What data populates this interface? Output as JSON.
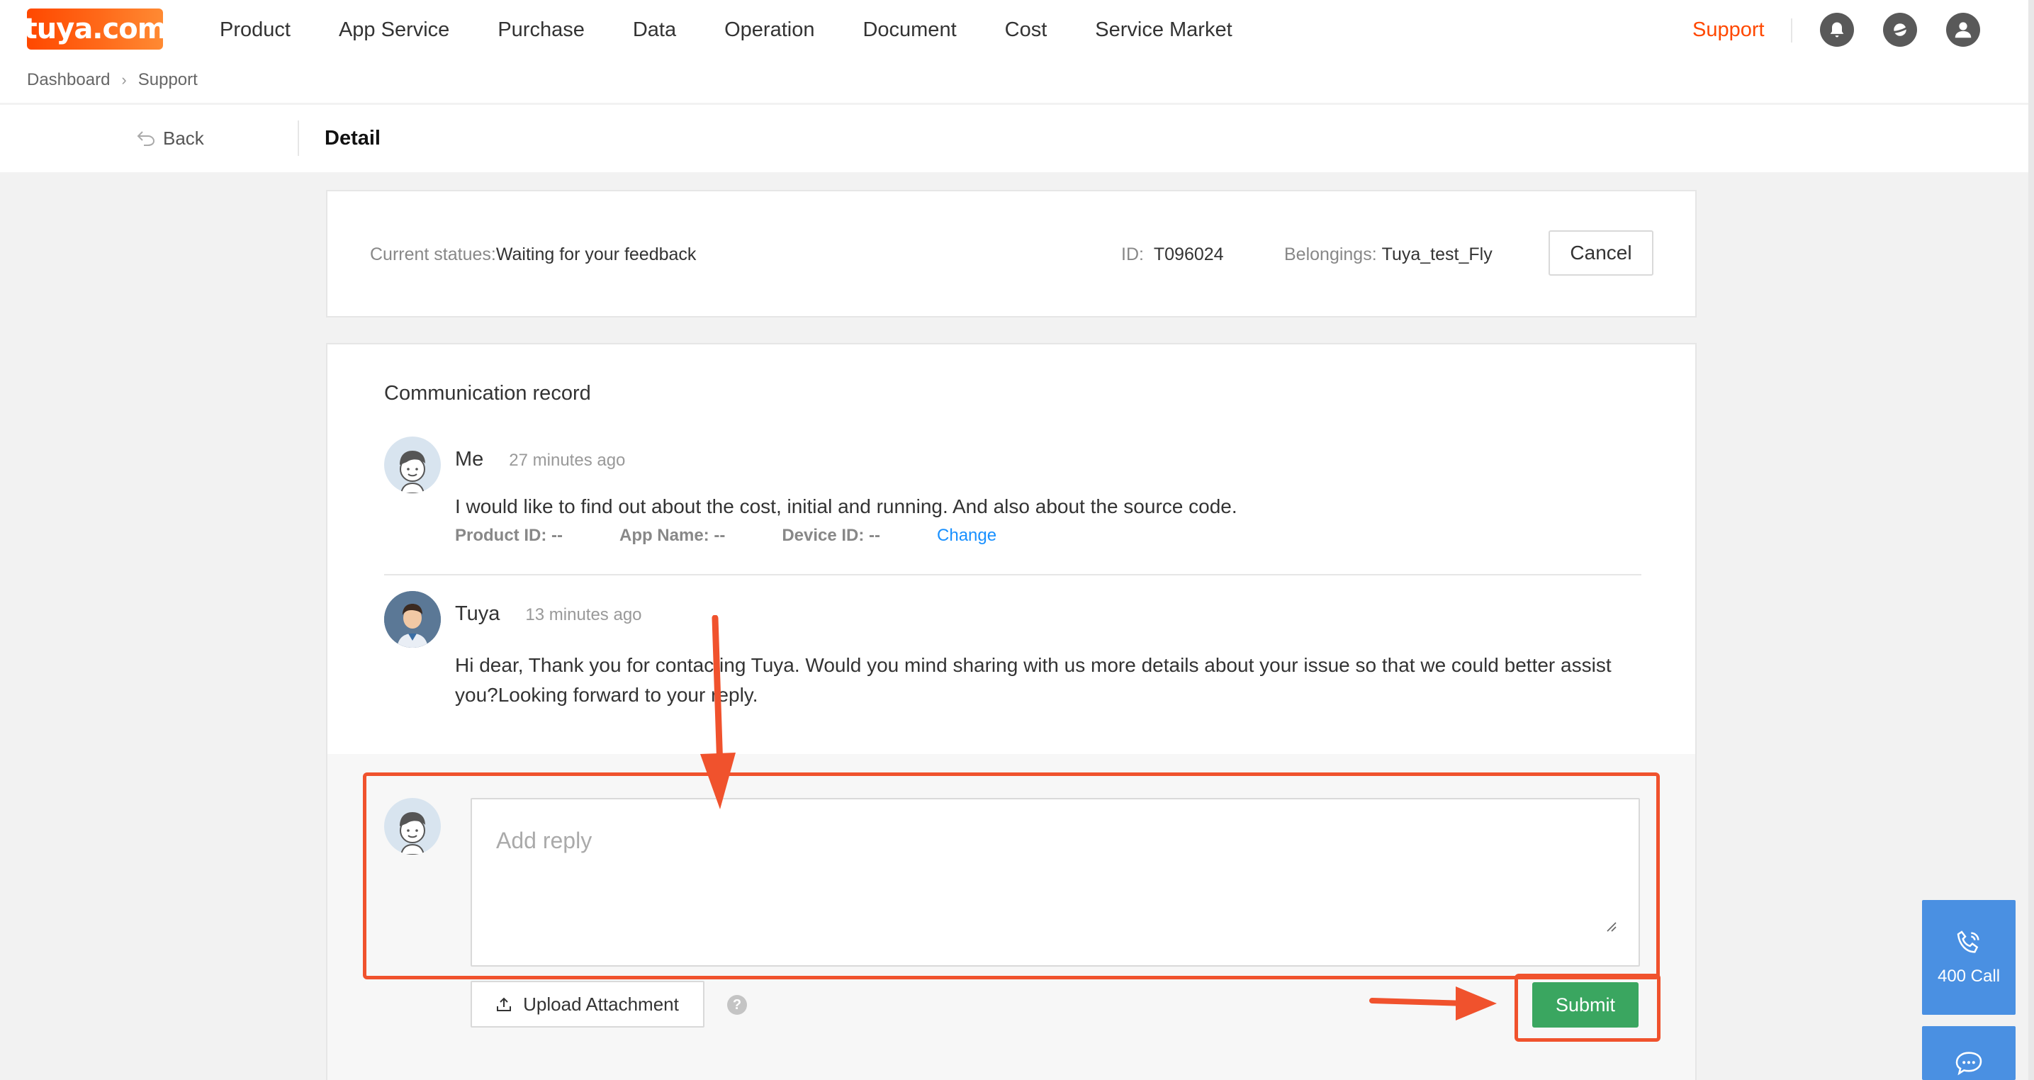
{
  "brand": {
    "logo_text": "tuya.com"
  },
  "nav": {
    "items": [
      "Product",
      "App Service",
      "Purchase",
      "Data",
      "Operation",
      "Document",
      "Cost",
      "Service Market"
    ],
    "support": "Support"
  },
  "header_icons": [
    "bell-icon",
    "planet-icon",
    "user-icon"
  ],
  "breadcrumb": {
    "items": [
      "Dashboard",
      "Support"
    ]
  },
  "detail_bar": {
    "back": "Back",
    "title": "Detail"
  },
  "status": {
    "status_label": "Current statues:",
    "status_value": "Waiting for your feedback",
    "id_label": "ID:",
    "id_value": "T096024",
    "belong_label": "Belongings:",
    "belong_value": "Tuya_test_Fly",
    "cancel": "Cancel"
  },
  "communication": {
    "title": "Communication record",
    "messages": [
      {
        "name": "Me",
        "time": "27 minutes ago",
        "body": "I would like to find out about the cost, initial and running. And also about the source code.",
        "meta": {
          "product_id": "Product ID: --",
          "app_name": "App Name: --",
          "device_id": "Device ID: --",
          "change": "Change"
        }
      },
      {
        "name": "Tuya",
        "time": "13 minutes ago",
        "body": "Hi dear, Thank you for contacting Tuya. Would you mind sharing with us more details about your issue so that we could better assist you?Looking forward to your reply."
      }
    ],
    "reply": {
      "placeholder": "Add reply",
      "upload": "Upload Attachment",
      "help": "?",
      "submit": "Submit"
    }
  },
  "side_buttons": {
    "call": "400 Call"
  },
  "colors": {
    "accent": "#ff4800",
    "submit": "#3aa660",
    "link": "#1890ff",
    "annotation": "#f0522d",
    "side": "#4a90e2"
  }
}
